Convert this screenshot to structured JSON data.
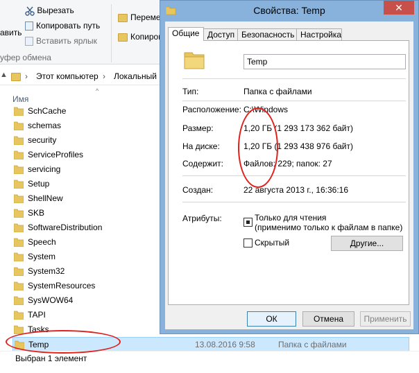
{
  "ribbon": {
    "cut": "Вырезать",
    "copy_path": "Копировать путь",
    "paste_shortcut": "Вставить ярлык",
    "paste_partial": "авить",
    "clipboard_group": "уфер обмена",
    "move_to": "Переме",
    "copy_to": "Копиров"
  },
  "address": {
    "this_pc": "Этот компьютер",
    "local": "Локальный"
  },
  "list": {
    "column_name": "Имя",
    "items": [
      "SchCache",
      "schemas",
      "security",
      "ServiceProfiles",
      "servicing",
      "Setup",
      "ShellNew",
      "SKB",
      "SoftwareDistribution",
      "Speech",
      "System",
      "System32",
      "SystemResources",
      "SysWOW64",
      "TAPI",
      "Tasks"
    ],
    "selected": {
      "name": "Temp",
      "date": "13.08.2016 9:58",
      "type": "Папка с файлами"
    },
    "status": "Выбран 1 элемент"
  },
  "dialog": {
    "title": "Свойства: Temp",
    "close": "✕",
    "tabs": [
      "Общие",
      "Доступ",
      "Безопасность",
      "Настройка"
    ],
    "name_value": "Temp",
    "type_label": "Тип:",
    "type_value": "Папка с файлами",
    "location_label": "Расположение:",
    "location_value": "C:\\Windows",
    "size_label": "Размер:",
    "size_value": "1,20 ГБ (1 293 173 362 байт)",
    "disk_label": "На диске:",
    "disk_value": "1,20 ГБ (1 293 438 976 байт)",
    "contains_label": "Содержит:",
    "contains_value": "Файлов: 229; папок: 27",
    "created_label": "Создан:",
    "created_value": "22 августа 2013 г., 16:36:16",
    "attributes_label": "Атрибуты:",
    "readonly_line1": "Только для чтения",
    "readonly_line2": "(применимо только к файлам в папке)",
    "hidden_label": "Скрытый",
    "other_button": "Другие...",
    "ok": "ОК",
    "cancel": "Отмена",
    "apply": "Применить"
  },
  "colors": {
    "annotation": "#e0201c",
    "selection": "#cce8ff",
    "folder": "#e8c65f"
  }
}
